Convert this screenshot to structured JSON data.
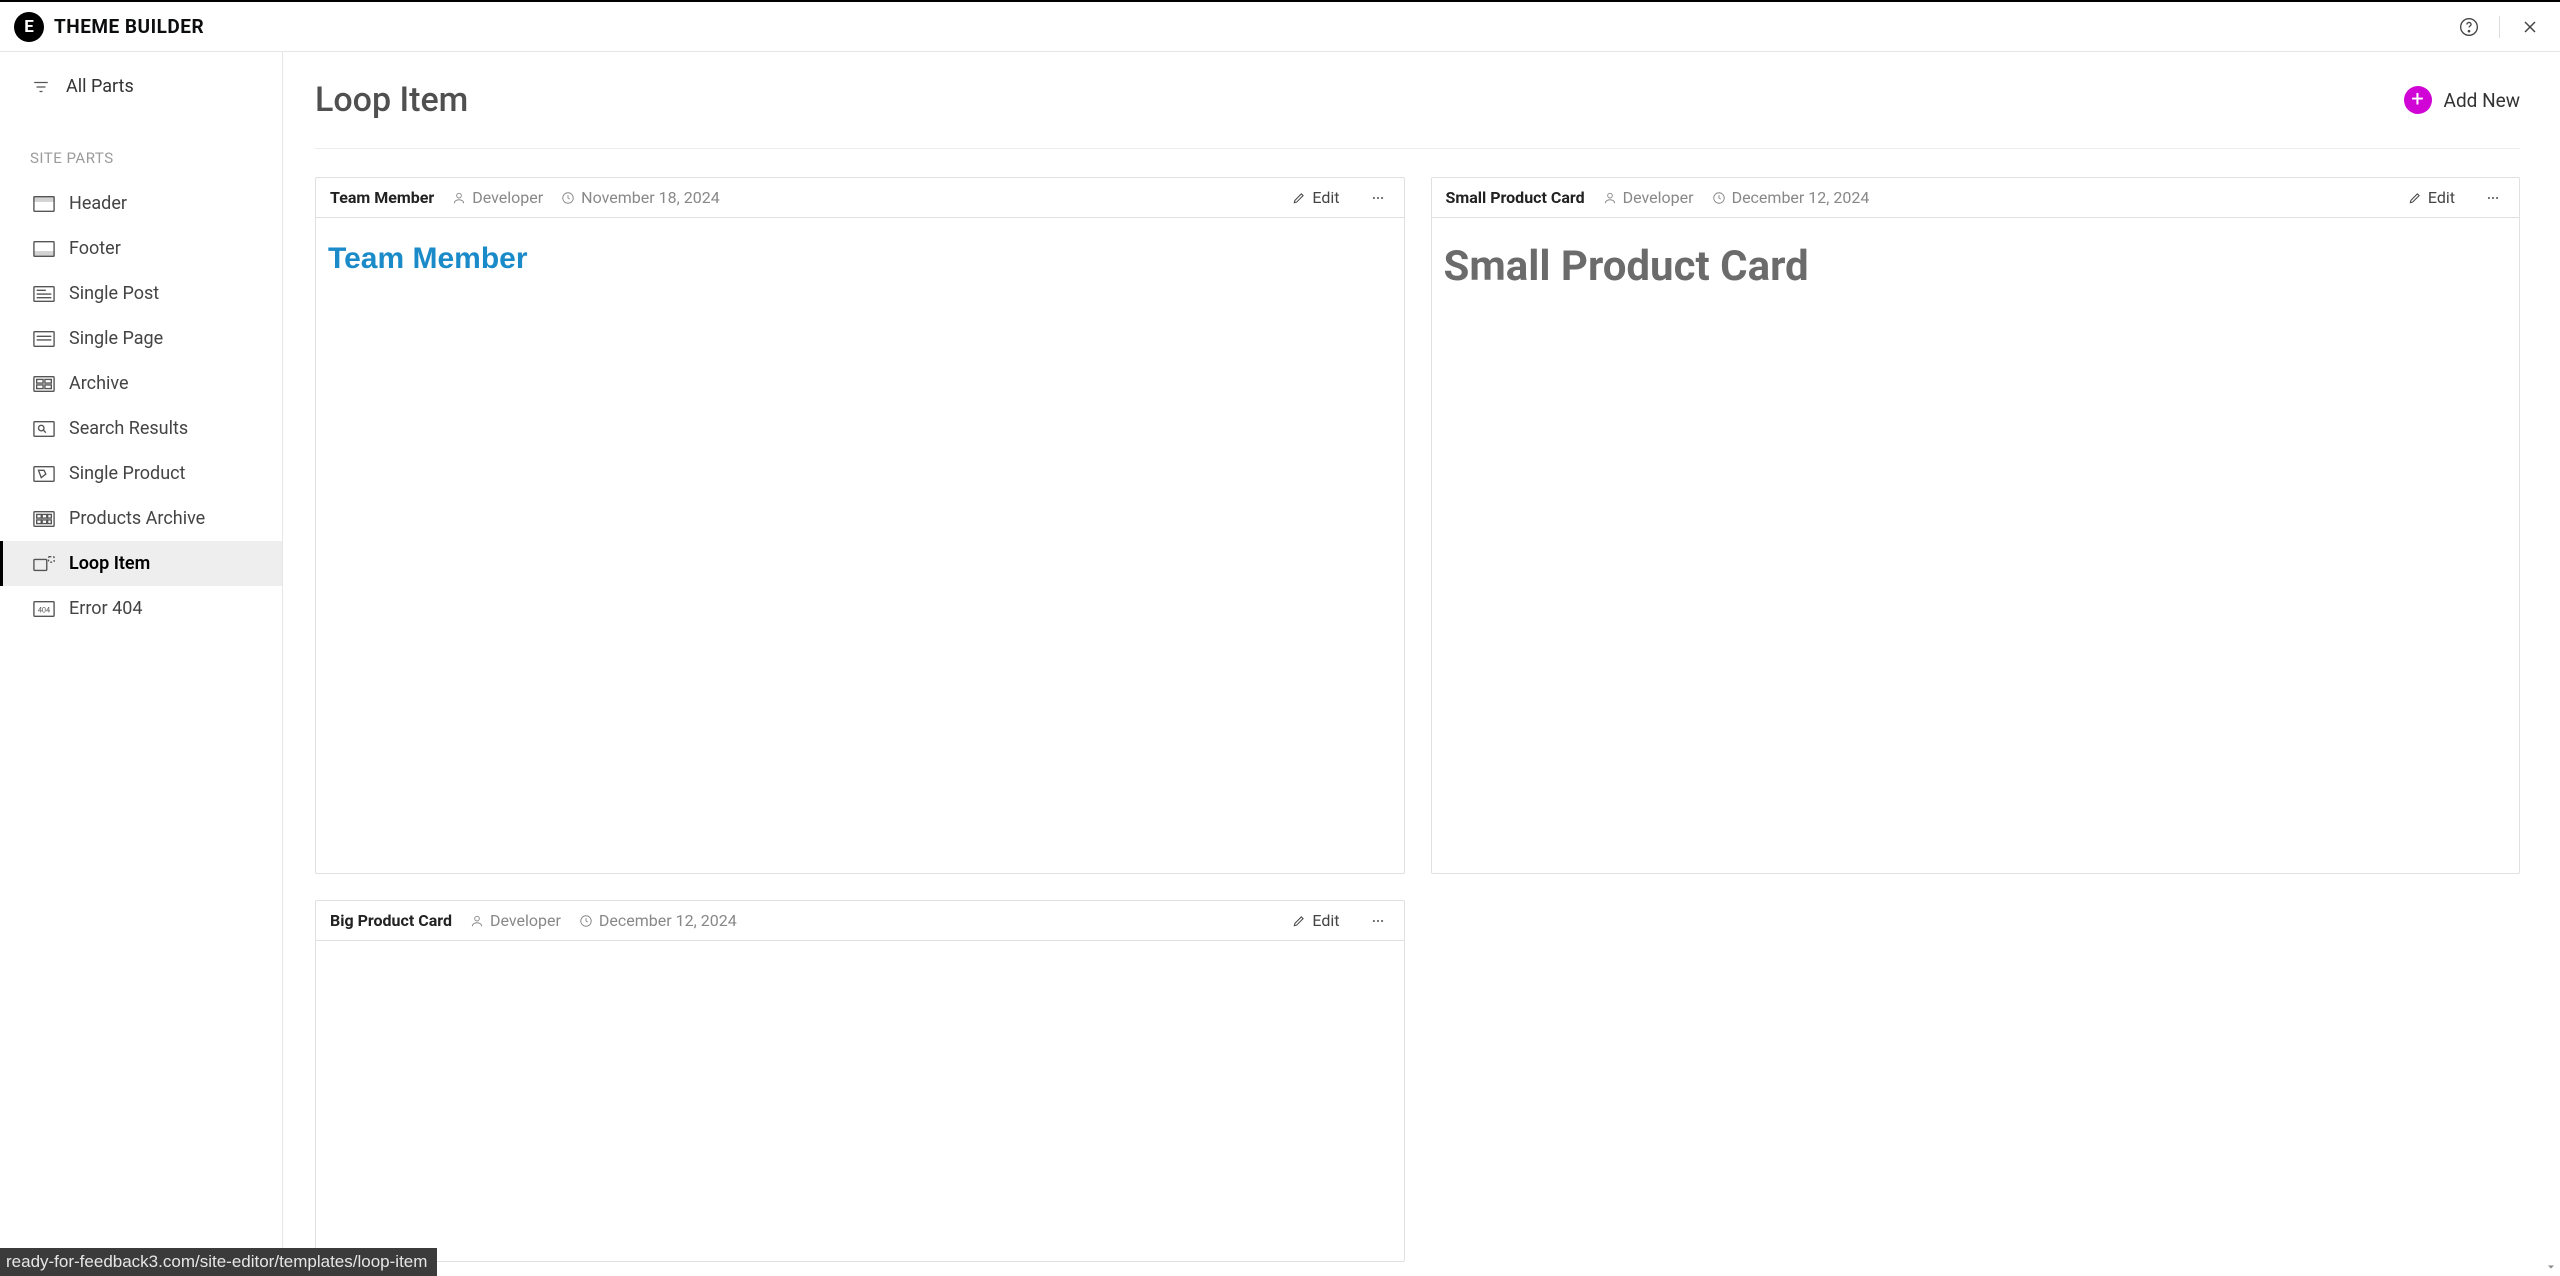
{
  "header": {
    "logo_letter": "E",
    "title": "THEME BUILDER"
  },
  "sidebar": {
    "all_parts_label": "All Parts",
    "section_label": "SITE PARTS",
    "items": [
      {
        "label": "Header"
      },
      {
        "label": "Footer"
      },
      {
        "label": "Single Post"
      },
      {
        "label": "Single Page"
      },
      {
        "label": "Archive"
      },
      {
        "label": "Search Results"
      },
      {
        "label": "Single Product"
      },
      {
        "label": "Products Archive"
      },
      {
        "label": "Loop Item"
      },
      {
        "label": "Error 404"
      }
    ],
    "active_index": 8
  },
  "main": {
    "page_title": "Loop Item",
    "add_new_label": "Add New"
  },
  "cards": [
    {
      "title": "Team Member",
      "author": "Developer",
      "date": "November 18, 2024",
      "edit_label": "Edit",
      "preview_title": "Team Member",
      "preview_style": "team"
    },
    {
      "title": "Small Product Card",
      "author": "Developer",
      "date": "December 12, 2024",
      "edit_label": "Edit",
      "preview_title": "Small Product Card",
      "preview_style": "small-product"
    },
    {
      "title": "Big Product Card",
      "author": "Developer",
      "date": "December 12, 2024",
      "edit_label": "Edit",
      "preview_title": "",
      "preview_style": "blank"
    }
  ],
  "status_bar": "ready-for-feedback3.com/site-editor/templates/loop-item"
}
